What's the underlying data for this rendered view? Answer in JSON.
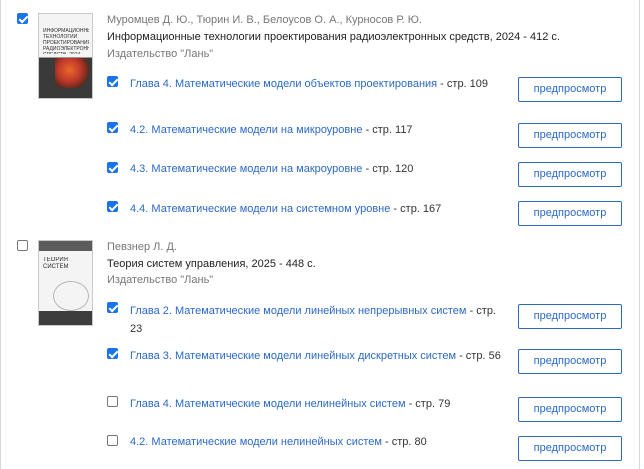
{
  "books": [
    {
      "checked": true,
      "authors": "Муромцев Д. Ю., Тюрин И. В., Белоусов О. А., Курносов Р. Ю.",
      "title": "Информационные технологии проектирования радиоэлектронных средств, 2024 - 412 с.",
      "publisher": "Издательство \"Лань\"",
      "chapters": [
        {
          "checked": true,
          "link": "Глава 4. Математические модели объектов проектирования",
          "page": " - стр. 109",
          "preview": "предпросмотр"
        },
        {
          "checked": true,
          "link": "4.2. Математические модели на микроуровне",
          "page": " - стр. 117",
          "preview": "предпросмотр"
        },
        {
          "checked": true,
          "link": "4.3. Математические модели на макроуровне",
          "page": " - стр. 120",
          "preview": "предпросмотр"
        },
        {
          "checked": true,
          "link": "4.4. Математические модели на системном уровне",
          "page": " - стр. 167",
          "preview": "предпросмотр"
        }
      ]
    },
    {
      "checked": false,
      "authors": "Певзнер Л. Д.",
      "title": "Теория систем управления, 2025 - 448 с.",
      "publisher": "Издательство \"Лань\"",
      "chapters": [
        {
          "checked": true,
          "link": "Глава 2. Математические модели линейных непрерывных систем",
          "page": " - стр. 23",
          "preview": "предпросмотр"
        },
        {
          "checked": true,
          "link": "Глава 3. Математические модели линейных дискретных систем",
          "page": " - стр. 56",
          "preview": "предпросмотр"
        },
        {
          "checked": false,
          "link": "Глава 4. Математические модели нелинейных систем",
          "page": " - стр. 79",
          "preview": "предпросмотр"
        },
        {
          "checked": false,
          "link": "4.2. Математические модели нелинейных систем",
          "page": " - стр. 80",
          "preview": "предпросмотр"
        }
      ]
    }
  ]
}
